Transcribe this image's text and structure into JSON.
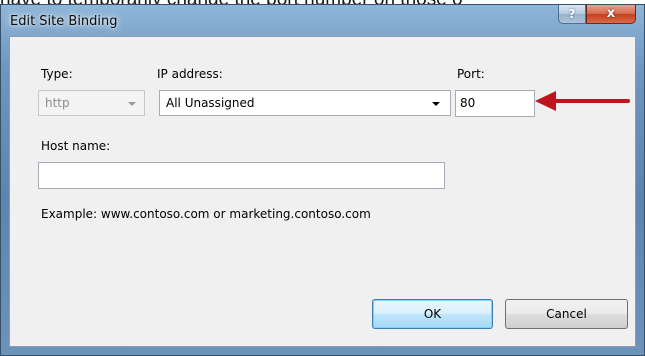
{
  "background": {
    "text": "have to temporarily change the port number on those o"
  },
  "dialog": {
    "title": "Edit Site Binding",
    "help_button": "?",
    "close_button": "x"
  },
  "form": {
    "type_label": "Type:",
    "type_value": "http",
    "ip_label": "IP address:",
    "ip_value": "All Unassigned",
    "port_label": "Port:",
    "port_value": "80",
    "host_label": "Host name:",
    "host_value": "",
    "example_text": "Example: www.contoso.com or marketing.contoso.com"
  },
  "buttons": {
    "ok": "OK",
    "cancel": "Cancel"
  },
  "annotation": {
    "arrow_color": "#c0141c",
    "icon": "red-arrow-icon"
  }
}
